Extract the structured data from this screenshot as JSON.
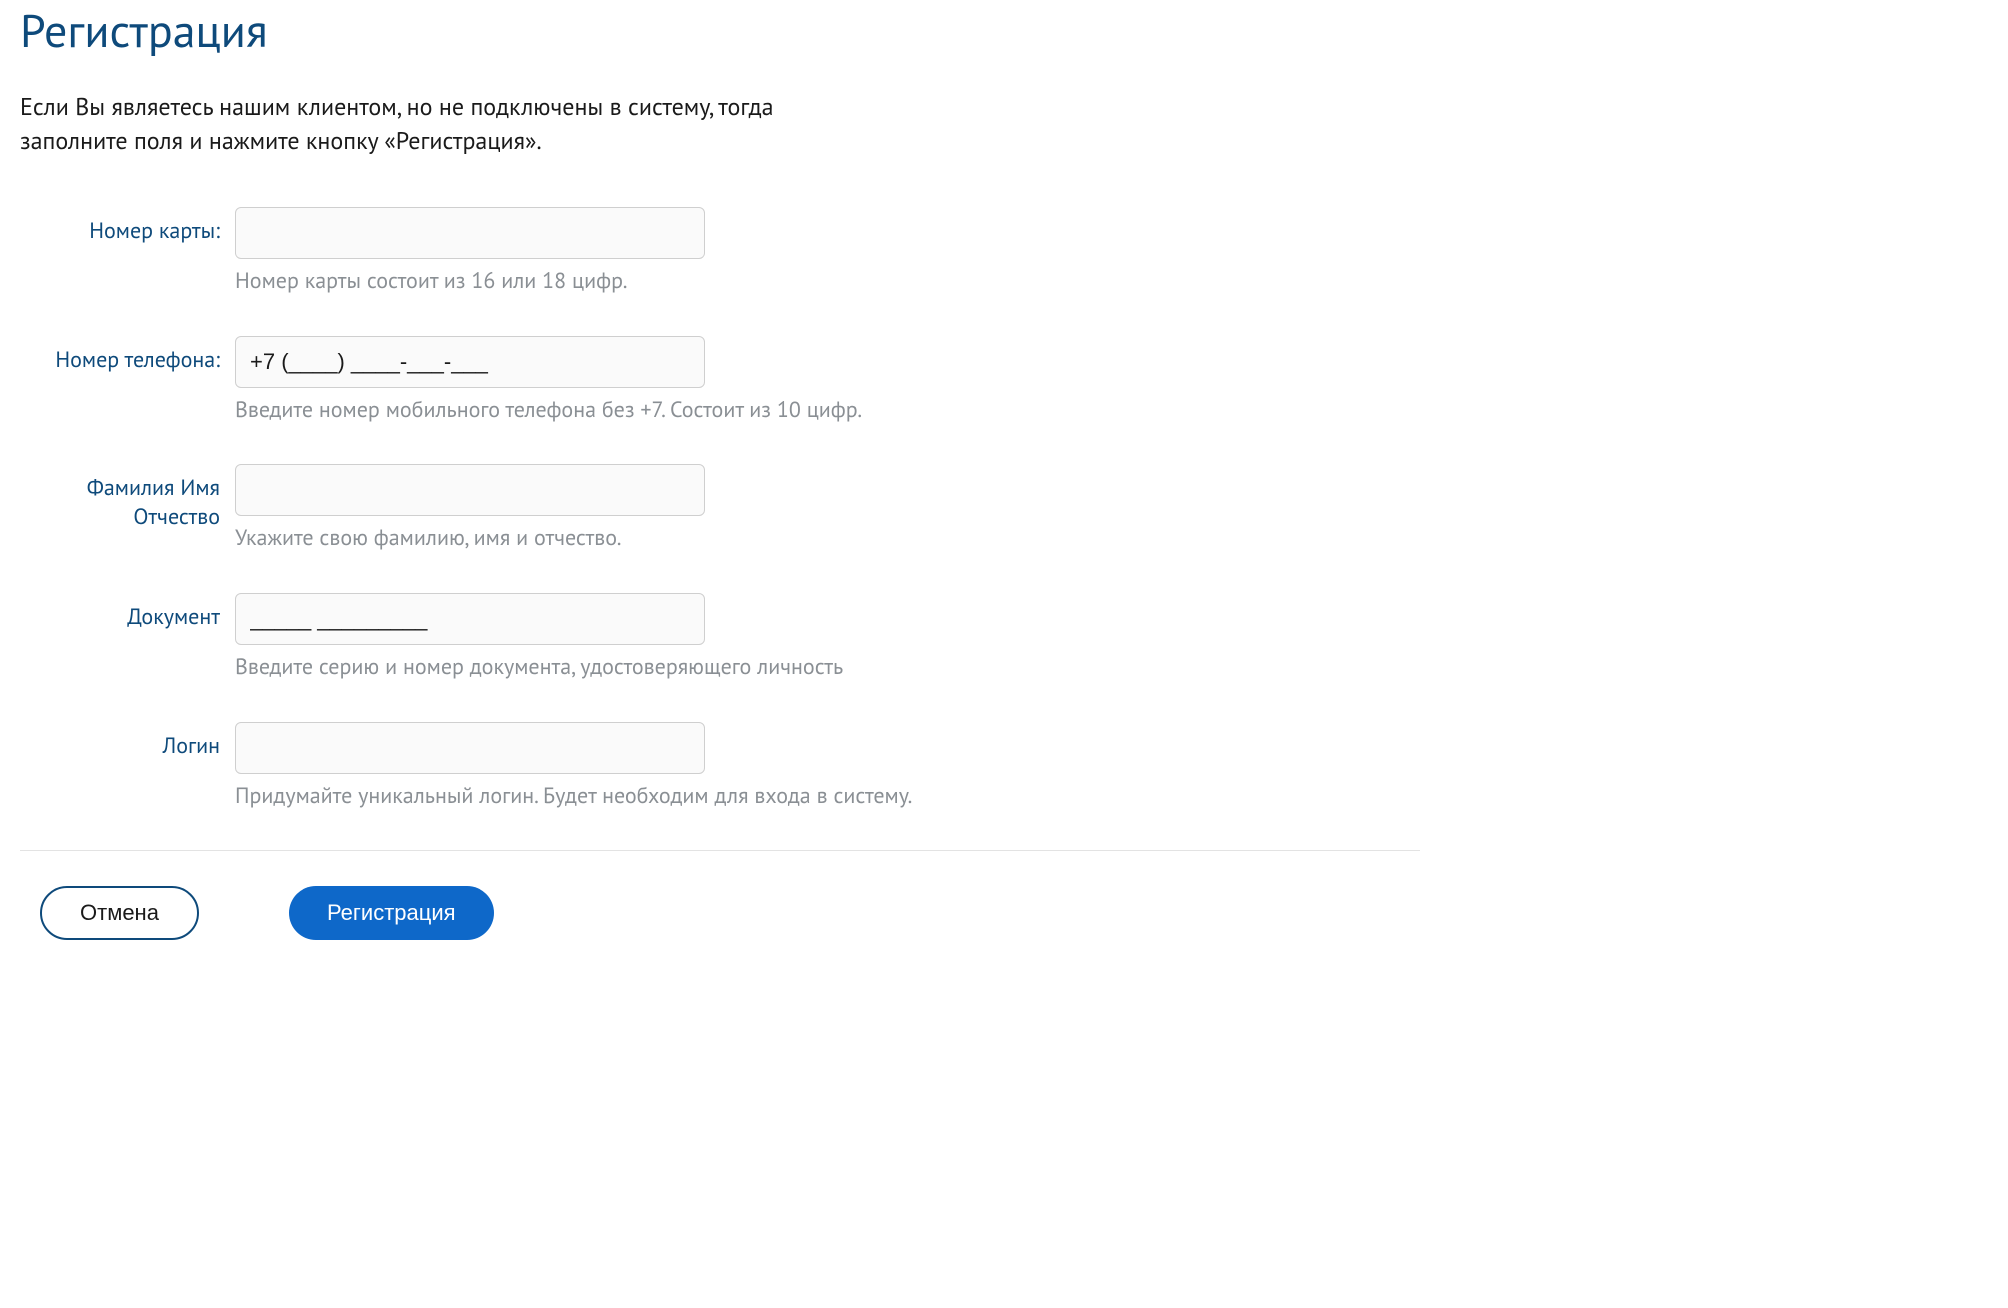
{
  "title": "Регистрация",
  "intro": "Если Вы являетесь нашим клиентом, но не подключены в систему, тогда заполните поля и нажмите кнопку «Регистрация».",
  "fields": {
    "card": {
      "label": "Номер карты:",
      "value": "",
      "hint": "Номер карты состоит из 16 или 18 цифр."
    },
    "phone": {
      "label": "Номер телефона:",
      "value": "+7 (____) ____-___-___",
      "hint": "Введите номер мобильного телефона без +7. Состоит из 10 цифр."
    },
    "fio": {
      "label": "Фамилия Имя Отчество",
      "value": "",
      "hint": "Укажите свою фамилию, имя и отчество."
    },
    "document": {
      "label": "Документ",
      "value": "_____ _________",
      "hint": "Введите серию и номер документа, удостоверяющего личность"
    },
    "login": {
      "label": "Логин",
      "value": "",
      "hint": "Придумайте уникальный логин. Будет необходим для входа в систему."
    }
  },
  "buttons": {
    "cancel": "Отмена",
    "submit": "Регистрация"
  }
}
